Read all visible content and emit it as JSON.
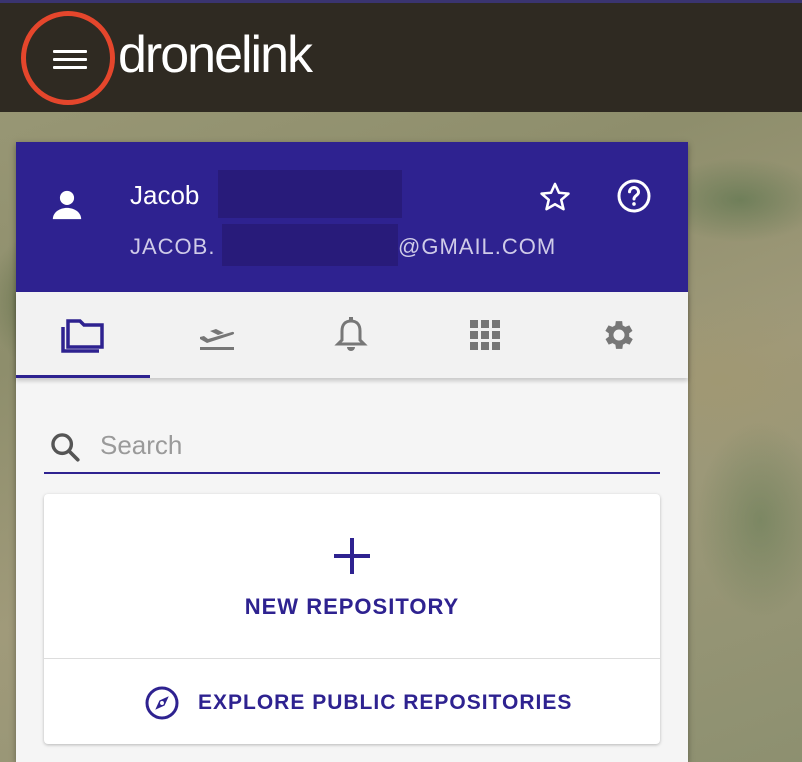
{
  "app": {
    "logo_text": "dronelink",
    "accent": "#2e2290"
  },
  "topbar": {
    "menu_icon": "hamburger-menu-icon"
  },
  "user": {
    "name": "Jacob",
    "email_prefix": "JACOB.",
    "email_suffix": "@GMAIL.COM",
    "icons": {
      "avatar": "person-icon",
      "favorite": "star-outline-icon",
      "help": "help-circle-icon"
    }
  },
  "tabs": [
    {
      "name": "repositories",
      "icon": "folders-icon",
      "active": true
    },
    {
      "name": "flights",
      "icon": "airplane-takeoff-icon",
      "active": false
    },
    {
      "name": "notifications",
      "icon": "bell-icon",
      "active": false
    },
    {
      "name": "apps",
      "icon": "apps-grid-icon",
      "active": false
    },
    {
      "name": "settings",
      "icon": "gear-icon",
      "active": false
    }
  ],
  "search": {
    "placeholder": "Search",
    "value": ""
  },
  "actions": {
    "new_repository": "NEW REPOSITORY",
    "explore_public": "EXPLORE PUBLIC REPOSITORIES"
  }
}
